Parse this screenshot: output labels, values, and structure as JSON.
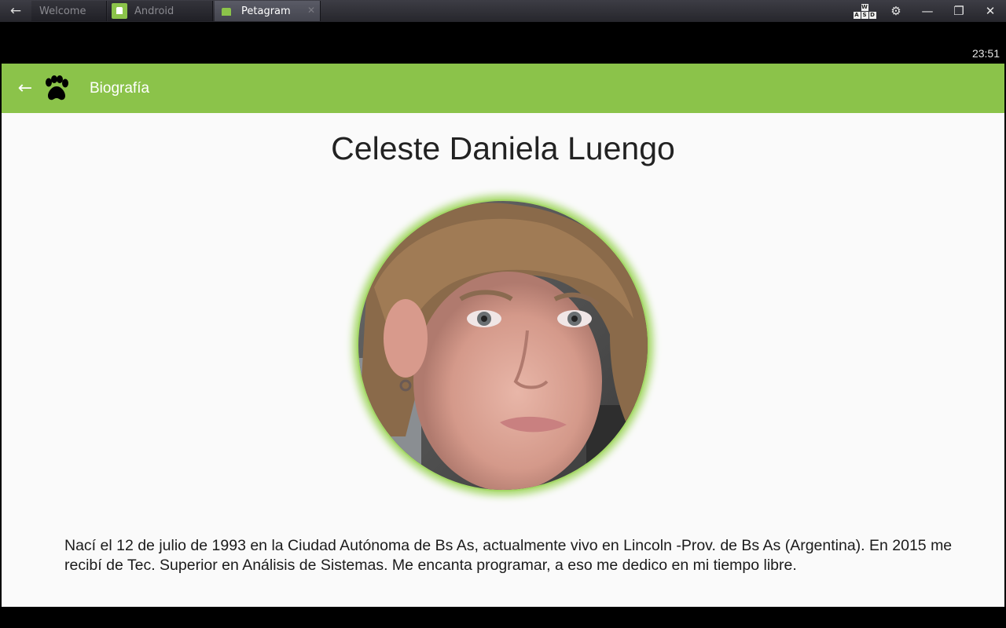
{
  "window": {
    "tabs": [
      {
        "label": "Welcome"
      },
      {
        "label": "Android"
      },
      {
        "label": "Petagram"
      }
    ],
    "keys": [
      "W",
      "A",
      "S",
      "D"
    ]
  },
  "statusbar": {
    "time": "23:51"
  },
  "appbar": {
    "title": "Biografía"
  },
  "profile": {
    "name": "Celeste Daniela Luengo",
    "bio": "Nací el 12 de julio de 1993 en la Ciudad Autónoma de Bs As, actualmente vivo en Lincoln -Prov. de Bs As (Argentina). En 2015 me recibí de Tec. Superior en Análisis de Sistemas. Me encanta programar, a eso me dedico en mi tiempo libre."
  },
  "colors": {
    "accent": "#8bc34a",
    "avatar_ring": "#a5d868"
  }
}
